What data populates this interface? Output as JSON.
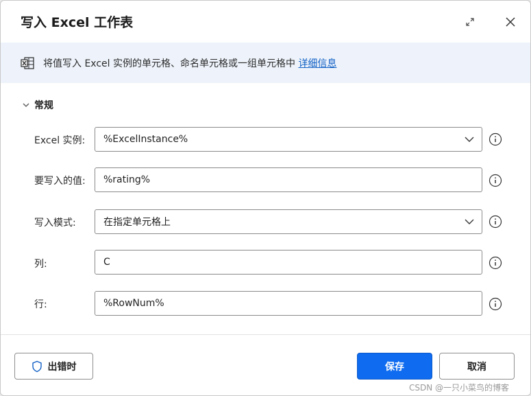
{
  "dialog": {
    "title": "写入 Excel 工作表"
  },
  "banner": {
    "text": "将值写入 Excel 实例的单元格、命名单元格或一组单元格中",
    "link": "详细信息"
  },
  "section": {
    "label": "常规"
  },
  "fields": {
    "excel_instance": {
      "label": "Excel 实例:",
      "value": "%ExcelInstance%"
    },
    "value_to_write": {
      "label": "要写入的值:",
      "value": "%rating%"
    },
    "write_mode": {
      "label": "写入模式:",
      "value": "在指定单元格上"
    },
    "column": {
      "label": "列:",
      "value": "C"
    },
    "row": {
      "label": "行:",
      "value": "%RowNum%"
    }
  },
  "footer": {
    "on_error_label": "出错时",
    "save_label": "保存",
    "cancel_label": "取消"
  },
  "watermark": "CSDN @一只小菜鸟的博客",
  "colors": {
    "primary": "#0f6cf0",
    "banner_bg": "#eef3fb",
    "link": "#0f5fc4"
  },
  "icons": {
    "expand": "expand-icon",
    "close": "close-icon",
    "excel": "excel-icon",
    "chevron": "chevron-down-icon",
    "info": "info-icon",
    "shield": "shield-icon"
  }
}
